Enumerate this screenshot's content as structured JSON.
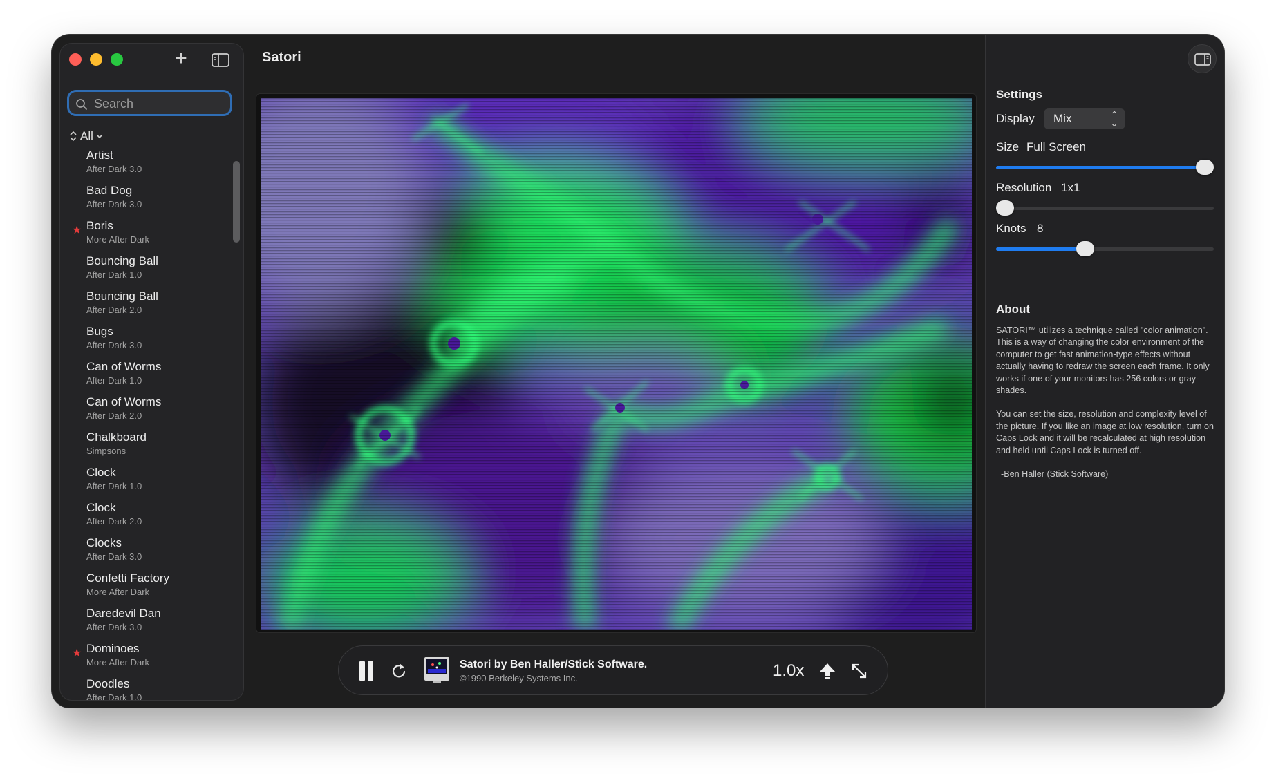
{
  "window": {
    "title": "Satori"
  },
  "sidebar": {
    "search_placeholder": "Search",
    "filter_label": "All",
    "items": [
      {
        "name": "Artist",
        "sub": "After Dark 3.0",
        "starred": false
      },
      {
        "name": "Bad Dog",
        "sub": "After Dark 3.0",
        "starred": false
      },
      {
        "name": "Boris",
        "sub": "More After Dark",
        "starred": true
      },
      {
        "name": "Bouncing Ball",
        "sub": "After Dark 1.0",
        "starred": false
      },
      {
        "name": "Bouncing Ball",
        "sub": "After Dark 2.0",
        "starred": false
      },
      {
        "name": "Bugs",
        "sub": "After Dark 3.0",
        "starred": false
      },
      {
        "name": "Can of Worms",
        "sub": "After Dark 1.0",
        "starred": false
      },
      {
        "name": "Can of Worms",
        "sub": "After Dark 2.0",
        "starred": false
      },
      {
        "name": "Chalkboard",
        "sub": "Simpsons",
        "starred": false
      },
      {
        "name": "Clock",
        "sub": "After Dark 1.0",
        "starred": false
      },
      {
        "name": "Clock",
        "sub": "After Dark 2.0",
        "starred": false
      },
      {
        "name": "Clocks",
        "sub": "After Dark 3.0",
        "starred": false
      },
      {
        "name": "Confetti Factory",
        "sub": "More After Dark",
        "starred": false
      },
      {
        "name": "Daredevil Dan",
        "sub": "After Dark 3.0",
        "starred": false
      },
      {
        "name": "Dominoes",
        "sub": "More After Dark",
        "starred": true
      },
      {
        "name": "Doodles",
        "sub": "After Dark 1.0",
        "starred": false
      }
    ],
    "star_glyph": "★"
  },
  "player": {
    "title": "Satori by Ben Haller/Stick Software.",
    "copyright": "©1990 Berkeley Systems Inc.",
    "speed": "1.0x"
  },
  "settings": {
    "heading": "Settings",
    "display_label": "Display",
    "display_value": "Mix",
    "size_label": "Size",
    "size_value": "Full Screen",
    "size_level": 1.0,
    "resolution_label": "Resolution",
    "resolution_value": "1x1",
    "resolution_level": 0.0,
    "knots_label": "Knots",
    "knots_value": "8",
    "knots_level": 0.4
  },
  "about": {
    "heading": "About",
    "paragraph1": "SATORI™ utilizes a technique called \"color animation\".  This is a way of changing the color environment of the computer to get fast animation-type effects without actually having to redraw the screen each frame.  It only works if one of your monitors has 256 colors or gray-shades.",
    "paragraph2": "You can set the size, resolution and complexity level of the picture.  If you like an image at low resolution, turn on Caps Lock and it will be recalculated at high resolution and held until Caps Lock is turned off.",
    "signature": "-Ben Haller  (Stick Software)"
  },
  "colors": {
    "accent": "#1f7cf0",
    "art_green": "#18e05a",
    "art_purple": "#5a1fa8",
    "star": "#e43b3b"
  }
}
